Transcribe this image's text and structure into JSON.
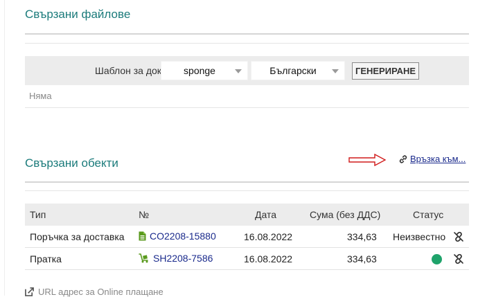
{
  "files": {
    "title": "Свързани файлове",
    "template_label": "Шаблон за документ",
    "template_value": "sponge",
    "language_value": "Български",
    "generate_label": "ГЕНЕРИРАНЕ",
    "empty_text": "Няма"
  },
  "objects": {
    "title": "Свързани обекти",
    "link_label": "Връзка към...",
    "columns": {
      "type": "Тип",
      "number": "№",
      "date": "Дата",
      "amount": "Сума (без ДДС)",
      "status": "Статус"
    },
    "rows": [
      {
        "type": "Поръчка за доставка",
        "number": "CO2208-15880",
        "date": "16.08.2022",
        "amount": "334,63",
        "status": "Неизвестно",
        "icon": "document-icon"
      },
      {
        "type": "Пратка",
        "number": "SH2208-7586",
        "date": "16.08.2022",
        "amount": "334,63",
        "status": "",
        "status_color": "#1fa36b",
        "icon": "dolly-icon"
      }
    ]
  },
  "footer": {
    "online_payment_label": "URL адрес за Online плащане"
  },
  "colors": {
    "title": "#1b7b7b",
    "link": "#1a2a8c",
    "icon_green": "#5a9a1e",
    "arrow_red": "#d11a1a"
  }
}
